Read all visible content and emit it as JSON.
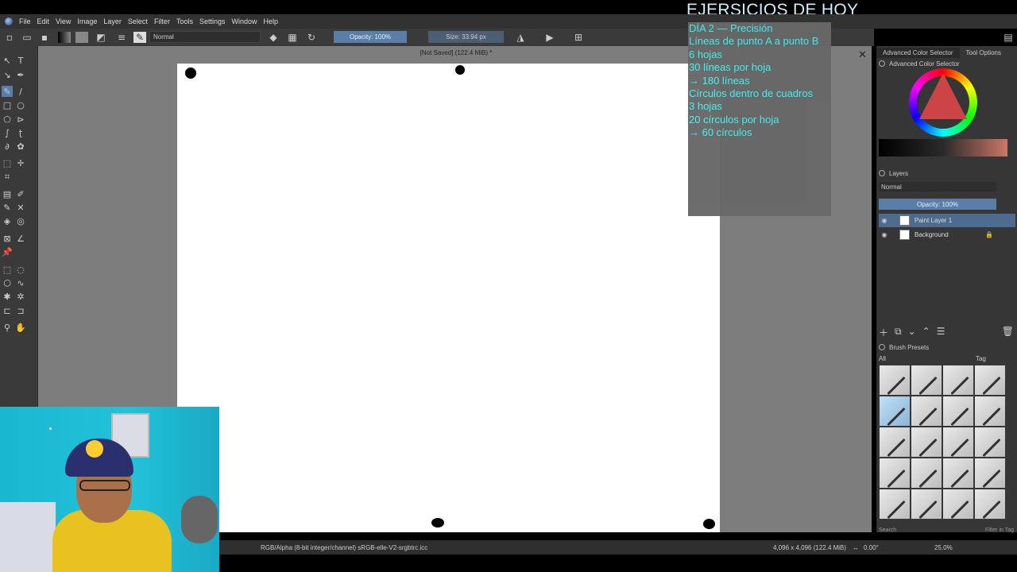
{
  "menubar": {
    "items": [
      "File",
      "Edit",
      "View",
      "Image",
      "Layer",
      "Select",
      "Filter",
      "Tools",
      "Settings",
      "Window",
      "Help"
    ]
  },
  "toolbar": {
    "blend_mode": "Normal",
    "opacity": "Opacity: 100%",
    "size": "Size: 33.94 px"
  },
  "document": {
    "title": "[Not Saved]  (122.4 MiB) *"
  },
  "overlay": {
    "title": "EJERSICIOS DE HOY",
    "lines": [
      "DÍA 2 — Precisión",
      "",
      "Líneas de punto A a punto B",
      "",
      "6 hojas",
      "",
      "30 líneas por hoja",
      "→ 180 líneas",
      "",
      "Círculos dentro de cuadros",
      "",
      "3 hojas",
      "",
      "20 círculos por hoja",
      "→ 60 círculos"
    ]
  },
  "right_panel": {
    "tabs": [
      "Advanced Color Selector",
      "Tool Options"
    ],
    "color_selector_title": "Advanced Color Selector",
    "layers_title": "Layers",
    "layer_blend": "Normal",
    "layer_opacity": "Opacity:  100%",
    "layers": [
      {
        "name": "Paint Layer 1",
        "selected": true
      },
      {
        "name": "Background",
        "selected": false
      }
    ],
    "brush_presets_title": "Brush Presets",
    "brush_filter": "All",
    "brush_tag": "Tag",
    "search_placeholder": "Search",
    "filter_in_tag": "Filter in Tag"
  },
  "status": {
    "color_space": "RGB/Alpha (8-bit integer/channel)  sRGB-elle-V2-srgbtrc.icc",
    "dimensions": "4,096 x 4,096 (122.4 MiB)",
    "rotation": "0.00°",
    "zoom": "25.0%"
  },
  "colors": {
    "accent": "#5a7ea8",
    "overlay_text": "#3ef3f3"
  }
}
